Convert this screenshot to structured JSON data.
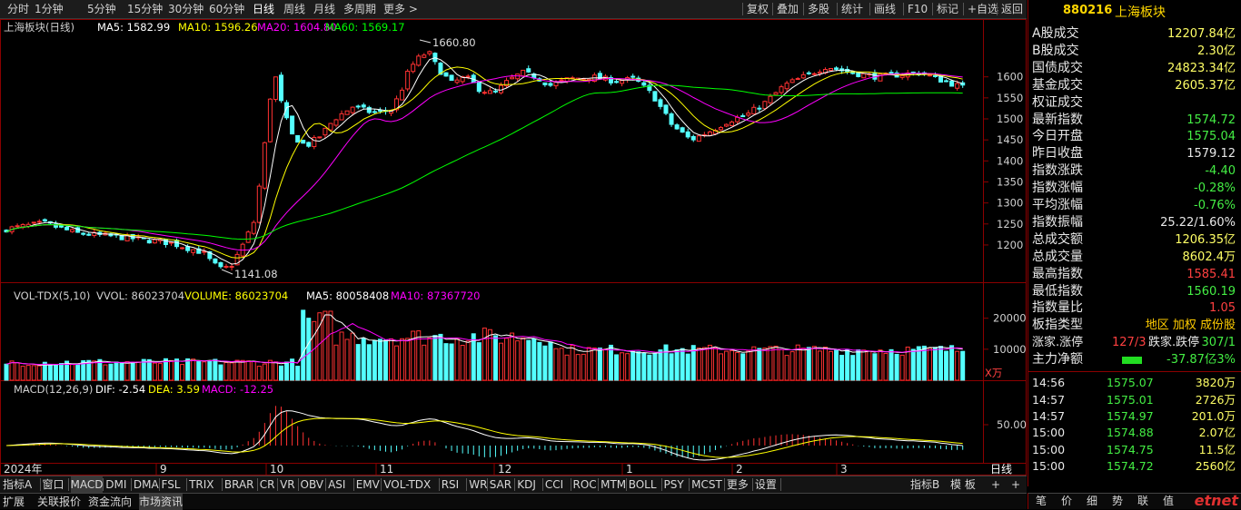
{
  "toolbar": {
    "periods": [
      "分时",
      "1分钟",
      "5分钟",
      "15分钟",
      "30分钟",
      "60分钟",
      "日线",
      "周线",
      "月线",
      "多周期",
      "更多 >"
    ],
    "active_period": "日线",
    "tools": [
      "复权",
      "叠加",
      "多股",
      "统计",
      "画线",
      "F10",
      "标记",
      "+自选",
      "返回"
    ]
  },
  "stock": {
    "code": "880216",
    "name": "上海板块"
  },
  "main_legend": {
    "title": "上海板块(日线)",
    "ma5_label": "MA5: 1582.99",
    "ma10_label": "MA10: 1596.26",
    "ma20_label": "MA20: 1604.80",
    "ma60_label": "MA60: 1569.17",
    "high_label": "1660.80",
    "low_label": "1141.08"
  },
  "vol_legend": {
    "title": "VOL-TDX(5,10)",
    "vvol": "VVOL: 86023704",
    "volume": "VOLUME: 86023704",
    "ma5": "MA5: 80058408",
    "ma10": "MA10: 87367720",
    "unit": "X万"
  },
  "macd_legend": {
    "title": "MACD(12,26,9)",
    "dif": "DIF: -2.54",
    "dea": "DEA: 3.59",
    "macd": "MACD: -12.25"
  },
  "axis": {
    "price_ticks": [
      "1600",
      "1550",
      "1500",
      "1450",
      "1400",
      "1350",
      "1300",
      "1250",
      "1200"
    ],
    "vol_ticks": [
      "20000",
      "10000"
    ],
    "macd_ticks": [
      "50.00"
    ],
    "dates": [
      "2024年",
      "9",
      "10",
      "11",
      "12",
      "1",
      "2",
      "3"
    ],
    "period_label": "日线"
  },
  "colors": {
    "up": "#ff3232",
    "down": "#54ffff",
    "ma5": "#ffffff",
    "ma10": "#ffff00",
    "ma20": "#ff00ff",
    "ma60": "#00ff00",
    "frame": "#8b0000"
  },
  "stats": [
    {
      "label": "A股成交",
      "value": "12207.84亿",
      "color": "y"
    },
    {
      "label": "B股成交",
      "value": "2.30亿",
      "color": "y"
    },
    {
      "label": "国债成交",
      "value": "24823.34亿",
      "color": "y"
    },
    {
      "label": "基金成交",
      "value": "2605.37亿",
      "color": "y"
    },
    {
      "label": "权证成交",
      "value": "",
      "color": "y"
    },
    {
      "label": "最新指数",
      "value": "1574.72",
      "color": "g"
    },
    {
      "label": "今日开盘",
      "value": "1575.04",
      "color": "g"
    },
    {
      "label": "昨日收盘",
      "value": "1579.12",
      "color": "w"
    },
    {
      "label": "指数涨跌",
      "value": "-4.40",
      "color": "g"
    },
    {
      "label": "指数涨幅",
      "value": "-0.28%",
      "color": "g"
    },
    {
      "label": "平均涨幅",
      "value": "-0.76%",
      "color": "g"
    },
    {
      "label": "指数振幅",
      "value": "25.22/1.60%",
      "color": "w"
    },
    {
      "label": "总成交额",
      "value": "1206.35亿",
      "color": "y"
    },
    {
      "label": "总成交量",
      "value": "8602.4万",
      "color": "y"
    },
    {
      "label": "最高指数",
      "value": "1585.41",
      "color": "r"
    },
    {
      "label": "最低指数",
      "value": "1560.19",
      "color": "g"
    },
    {
      "label": "指数量比",
      "value": "1.05",
      "color": "r"
    }
  ],
  "board": {
    "type_label": "板指类型",
    "type_value": "地区 加权 成份股",
    "up_label": "涨家.涨停",
    "up_value": "127/3",
    "down_label": "跌家.跌停",
    "down_value": "307/1",
    "flow_label": "主力净额",
    "flow_value": "-37.87亿",
    "flow_pct": "-3%"
  },
  "ticks": [
    {
      "time": "14:56",
      "price": "1575.07",
      "vol": "3820万"
    },
    {
      "time": "14:57",
      "price": "1575.01",
      "vol": "2726万"
    },
    {
      "time": "14:57",
      "price": "1574.97",
      "vol": "201.0万"
    },
    {
      "time": "15:00",
      "price": "1574.88",
      "vol": "2.07亿"
    },
    {
      "time": "15:00",
      "price": "1574.75",
      "vol": "11.5亿"
    },
    {
      "time": "15:00",
      "price": "1574.72",
      "vol": "2560亿"
    }
  ],
  "indicator_tabs": [
    "指标A",
    "窗口",
    "MACD",
    "DMI",
    "DMA",
    "FSL",
    "TRIX",
    "BRAR",
    "CR",
    "VR",
    "OBV",
    "ASI",
    "EMV",
    "VOL-TDX",
    "RSI",
    "WR",
    "SAR",
    "KDJ",
    "CCI",
    "ROC",
    "MTM",
    "BOLL",
    "PSY",
    "MCST",
    "更多",
    "设置"
  ],
  "indicator_right": [
    "指标B",
    "模 板",
    "+",
    "+"
  ],
  "bottom_tabs": [
    "扩展",
    "关联报价",
    "资金流向",
    "市场资讯"
  ],
  "rp_tabs": [
    "笔",
    "价",
    "细",
    "势",
    "联",
    "值"
  ],
  "logo": "etnet"
}
